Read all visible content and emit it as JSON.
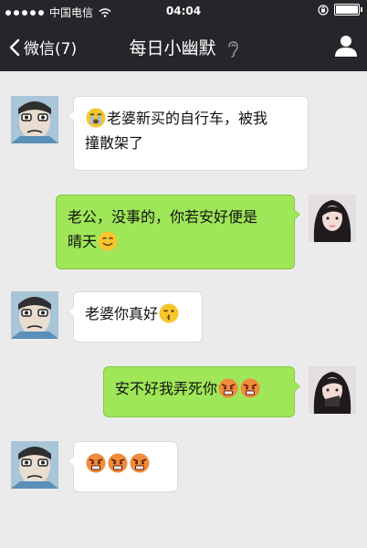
{
  "status_bar": {
    "carrier": "中国电信",
    "time": "04:04"
  },
  "nav": {
    "back_label": "微信(7)",
    "title": "每日小幽默"
  },
  "messages": [
    {
      "side": "in",
      "sender": "male",
      "text_line1": "老婆新买的自行车，被我",
      "text_line2": "撞散架了",
      "emoji": "crying-face"
    },
    {
      "side": "out",
      "sender": "female",
      "text_line1": "老公，没事的，你若安好便是",
      "text_line2": "晴天",
      "emoji": "smiling-face"
    },
    {
      "side": "in",
      "sender": "male",
      "text": "老婆你真好",
      "emoji": "kissing-face"
    },
    {
      "side": "out",
      "sender": "female",
      "text": "安不好我弄死你",
      "emoji": "angry-face"
    },
    {
      "side": "in",
      "sender": "male",
      "text": "",
      "emoji": "angry-face"
    }
  ],
  "colors": {
    "header_bg": "#25262a",
    "chat_bg": "#ebebeb",
    "out_bubble": "#9fe658",
    "in_bubble": "#ffffff"
  }
}
